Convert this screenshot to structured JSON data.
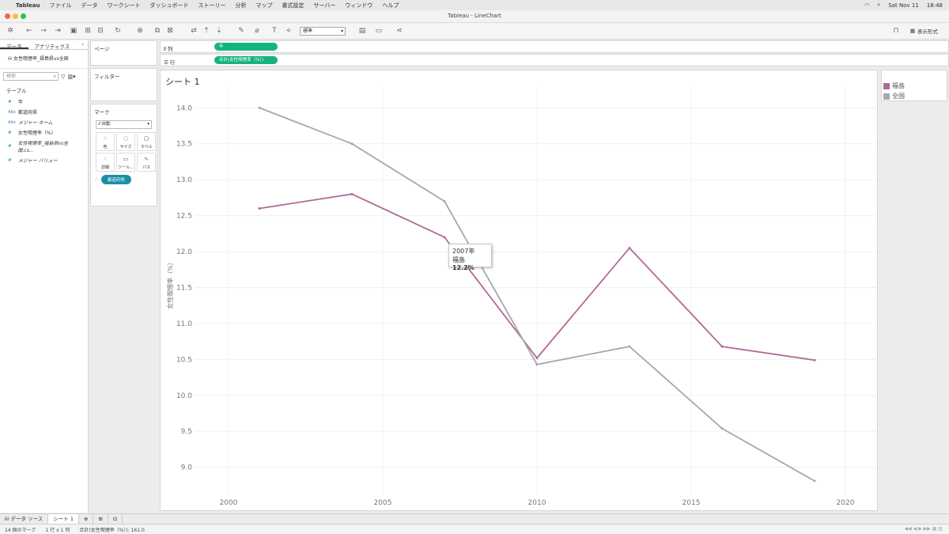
{
  "menubar": {
    "apple": "",
    "app": "Tableau",
    "items": [
      "ファイル",
      "データ",
      "ワークシート",
      "ダッシュボード",
      "ストーリー",
      "分析",
      "マップ",
      "書式設定",
      "サーバー",
      "ウィンドウ",
      "ヘルプ"
    ],
    "date": "Sat Nov 11",
    "time": "18:48"
  },
  "window": {
    "title": "Tableau - LineChart"
  },
  "toolbar": {
    "fit_select": "標準",
    "format_button": "表示形式"
  },
  "datapane": {
    "tabs": [
      "データ",
      "アナリティクス"
    ],
    "datasource": "女性喫煙率_福島県vs全国",
    "search_placeholder": "検索",
    "section": "テーブル",
    "fields": [
      {
        "icon": "#",
        "label": "年",
        "kind": "dim"
      },
      {
        "icon": "Abc",
        "label": "都道府県",
        "kind": "dim"
      },
      {
        "icon": "Abc",
        "label": "メジャー ネーム",
        "kind": "dim-italic"
      },
      {
        "icon": "#",
        "label": "女性喫煙率（%）",
        "kind": "measure"
      },
      {
        "icon": "#",
        "label": "女性喫煙率_福島県vs全国.cs...",
        "kind": "measure-italic"
      },
      {
        "icon": "#",
        "label": "メジャー バリュー",
        "kind": "measure-italic"
      }
    ]
  },
  "cards": {
    "pages": "ページ",
    "filters": "フィルター",
    "marks": "マーク",
    "mark_type": "自動",
    "mark_buttons": [
      "色",
      "サイズ",
      "ラベル",
      "詳細",
      "ツール...",
      "パス"
    ],
    "color_pill": "都道府県"
  },
  "shelves": {
    "columns_label": "列",
    "columns_pill": "年",
    "rows_label": "行",
    "rows_pill": "合計(女性喫煙率（%）)"
  },
  "sheet_title": "シート 1",
  "legend": {
    "items": [
      {
        "label": "福島",
        "color": "#b06a97"
      },
      {
        "label": "全国",
        "color": "#a8a8a8"
      }
    ]
  },
  "tooltip": {
    "year": "2007年",
    "series": "福島",
    "value": "12.2%"
  },
  "chart_data": {
    "type": "line",
    "ylabel": "女性喫煙率（%）",
    "xlabel": "",
    "xlim": [
      1998,
      2021
    ],
    "ylim": [
      8.6,
      14.3
    ],
    "x_ticks": [
      2000,
      2005,
      2010,
      2015,
      2020
    ],
    "y_ticks": [
      "9.0",
      "9.5",
      "10.0",
      "10.5",
      "11.0",
      "11.5",
      "12.0",
      "12.5",
      "13.0",
      "13.5",
      "14.0"
    ],
    "grid": true,
    "legend_position": "right",
    "series": [
      {
        "name": "福島",
        "color": "#b06a97",
        "x": [
          2001,
          2004,
          2007,
          2010,
          2013,
          2016,
          2019
        ],
        "y": [
          12.6,
          12.8,
          12.2,
          10.52,
          12.05,
          10.68,
          10.49
        ]
      },
      {
        "name": "全国",
        "color": "#a8a8a8",
        "x": [
          2001,
          2004,
          2007,
          2010,
          2013,
          2016,
          2019
        ],
        "y": [
          14.0,
          13.5,
          12.7,
          10.43,
          10.68,
          9.54,
          8.81
        ]
      }
    ]
  },
  "bottom": {
    "datasource_tab": "データ ソース",
    "sheet_tab": "シート 1"
  },
  "status": {
    "marks": "14 個のマーク",
    "grid": "1 行 x 1 列",
    "sum": "合計(女性喫煙率（%）): 161.0"
  }
}
